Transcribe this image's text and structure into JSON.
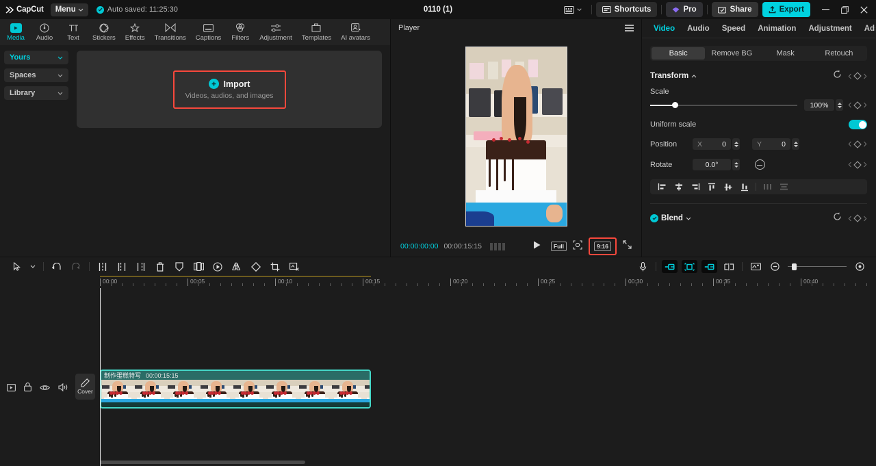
{
  "titlebar": {
    "app_name": "CapCut",
    "menu_label": "Menu",
    "autosave_text": "Auto saved: 11:25:30",
    "project_title": "0110 (1)",
    "shortcuts_label": "Shortcuts",
    "pro_label": "Pro",
    "share_label": "Share",
    "export_label": "Export",
    "accent": "#00d2e0",
    "export_bg": "#00d2e0",
    "highlight_red": "#f8483c"
  },
  "nav_tabs": [
    {
      "label": "Media",
      "icon": "media-icon",
      "active": true
    },
    {
      "label": "Audio",
      "icon": "audio-icon",
      "active": false
    },
    {
      "label": "Text",
      "icon": "text-icon",
      "active": false
    },
    {
      "label": "Stickers",
      "icon": "stickers-icon",
      "active": false
    },
    {
      "label": "Effects",
      "icon": "effects-icon",
      "active": false
    },
    {
      "label": "Transitions",
      "icon": "transitions-icon",
      "active": false
    },
    {
      "label": "Captions",
      "icon": "captions-icon",
      "active": false
    },
    {
      "label": "Filters",
      "icon": "filters-icon",
      "active": false
    },
    {
      "label": "Adjustment",
      "icon": "adjustment-icon",
      "active": false
    },
    {
      "label": "Templates",
      "icon": "templates-icon",
      "active": false
    },
    {
      "label": "AI avatars",
      "icon": "ai-avatars-icon",
      "active": false
    }
  ],
  "sidebar": {
    "items": [
      {
        "label": "Yours",
        "active": true
      },
      {
        "label": "Spaces",
        "active": false
      },
      {
        "label": "Library",
        "active": false
      }
    ]
  },
  "media_panel": {
    "import_label": "Import",
    "import_subtitle": "Videos, audios, and images",
    "highlighted": true
  },
  "player": {
    "title": "Player",
    "current_time": "00:00:00:00",
    "total_time": "00:00:15:15",
    "quality_label": "Full",
    "ratio_label": "9:16",
    "ratio_highlighted": true
  },
  "right_panel": {
    "tabs": [
      {
        "label": "Video",
        "active": true
      },
      {
        "label": "Audio",
        "active": false
      },
      {
        "label": "Speed",
        "active": false
      },
      {
        "label": "Animation",
        "active": false
      },
      {
        "label": "Adjustment",
        "active": false
      },
      {
        "label": "Ads",
        "active": false
      }
    ],
    "sub_tabs": [
      {
        "label": "Basic",
        "active": true
      },
      {
        "label": "Remove BG",
        "active": false
      },
      {
        "label": "Mask",
        "active": false
      },
      {
        "label": "Retouch",
        "active": false
      }
    ],
    "transform": {
      "title": "Transform",
      "scale_label": "Scale",
      "scale_value": "100%",
      "uniform_scale_label": "Uniform scale",
      "uniform_scale_on": true,
      "position_label": "Position",
      "position_x_axis": "X",
      "position_x_value": "0",
      "position_y_axis": "Y",
      "position_y_value": "0",
      "rotate_label": "Rotate",
      "rotate_value": "0.0°"
    },
    "align_icons": [
      "align-left-icon",
      "align-center-horizontal-icon",
      "align-right-icon",
      "align-top-icon",
      "align-middle-vertical-icon",
      "align-bottom-icon",
      "distribute-horizontal-icon",
      "distribute-vertical-icon"
    ],
    "blend": {
      "title": "Blend",
      "enabled": true
    }
  },
  "timeline": {
    "tools": [
      "select-arrow-icon",
      "chevron-down-icon",
      "undo-icon",
      "redo-icon",
      "split-icon",
      "split-left-icon",
      "split-right-icon",
      "delete-icon",
      "mask-shield-icon",
      "freeze-frame-icon",
      "speed-ramp-icon",
      "mirror-icon",
      "rotate-icon",
      "crop-icon",
      "remove-bg-icon"
    ],
    "right_tools": [
      "microphone-icon",
      "adsorption-icon",
      "auto-snap-icon",
      "link-icon",
      "timeline-mode-icon",
      "cover-frame-icon",
      "zoom-out-icon",
      "zoom-in-icon"
    ],
    "ruler_labels": [
      "00:00",
      "00:05",
      "00:10",
      "00:15",
      "00:20",
      "00:25",
      "00:30",
      "00:35",
      "00:40"
    ],
    "track_controls": [
      "video-track-icon",
      "lock-icon",
      "eye-icon",
      "volume-icon",
      "more-icon"
    ],
    "cover_label": "Cover",
    "clip": {
      "name": "制作蛋糕特写",
      "duration": "00:00:15:15",
      "selected": true,
      "border_color": "#44d8c8"
    }
  }
}
